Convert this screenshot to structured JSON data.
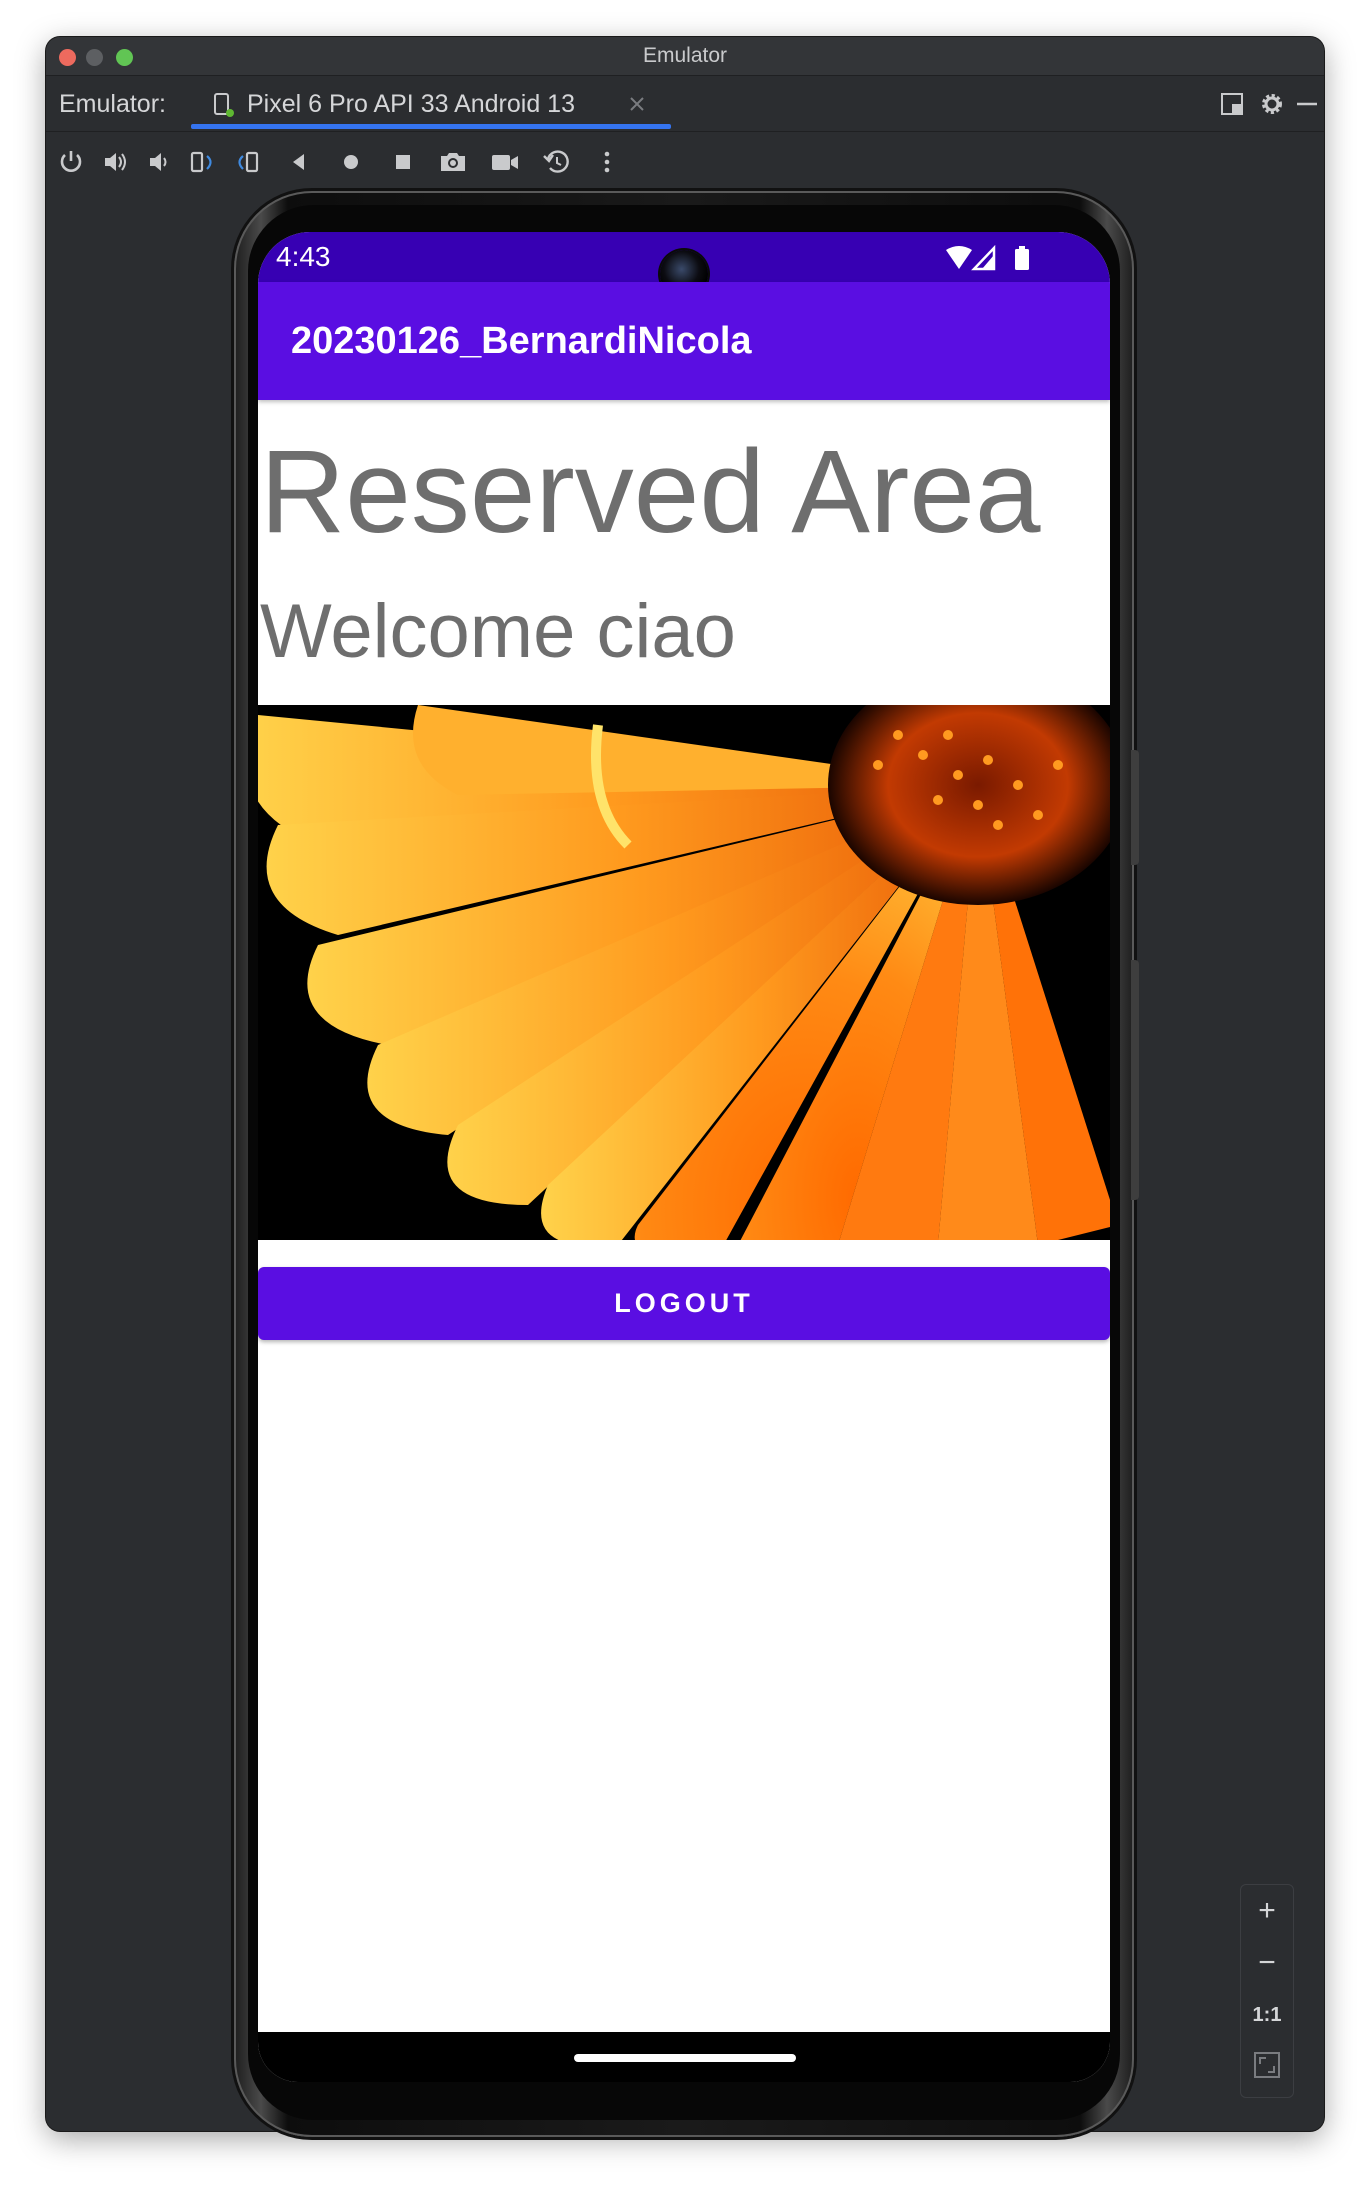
{
  "window": {
    "title": "Emulator"
  },
  "tabbar": {
    "prefix": "Emulator:",
    "tab_label": "Pixel 6 Pro API 33 Android 13",
    "actions": [
      "layout-icon",
      "gear-icon",
      "minimize-icon"
    ]
  },
  "toolbar": {
    "buttons": [
      "power-icon",
      "volume-up-icon",
      "volume-down-icon",
      "rotate-left-icon",
      "rotate-right-icon",
      "back-icon",
      "home-icon",
      "overview-icon",
      "camera-icon",
      "video-icon",
      "snapshot-icon",
      "more-icon"
    ]
  },
  "device": {
    "status_time": "4:43",
    "status_icons": [
      "wifi-icon",
      "signal-icon",
      "battery-icon"
    ]
  },
  "app": {
    "title": "20230126_BernardiNicola",
    "heading": "Reserved Area",
    "welcome": "Welcome ciao",
    "image": "orange-gerbera-flower-image",
    "logout_label": "LOGOUT"
  },
  "zoom": {
    "zoom_in": "+",
    "zoom_out": "−",
    "one_to_one": "1:1"
  },
  "colors": {
    "status_bar": "#3700b3",
    "app_bar": "#5a0ee2",
    "button": "#5a0ee2",
    "text_gray": "#6e6e6e",
    "ide_bg": "#2b2d30",
    "tab_underline": "#3574f0"
  }
}
